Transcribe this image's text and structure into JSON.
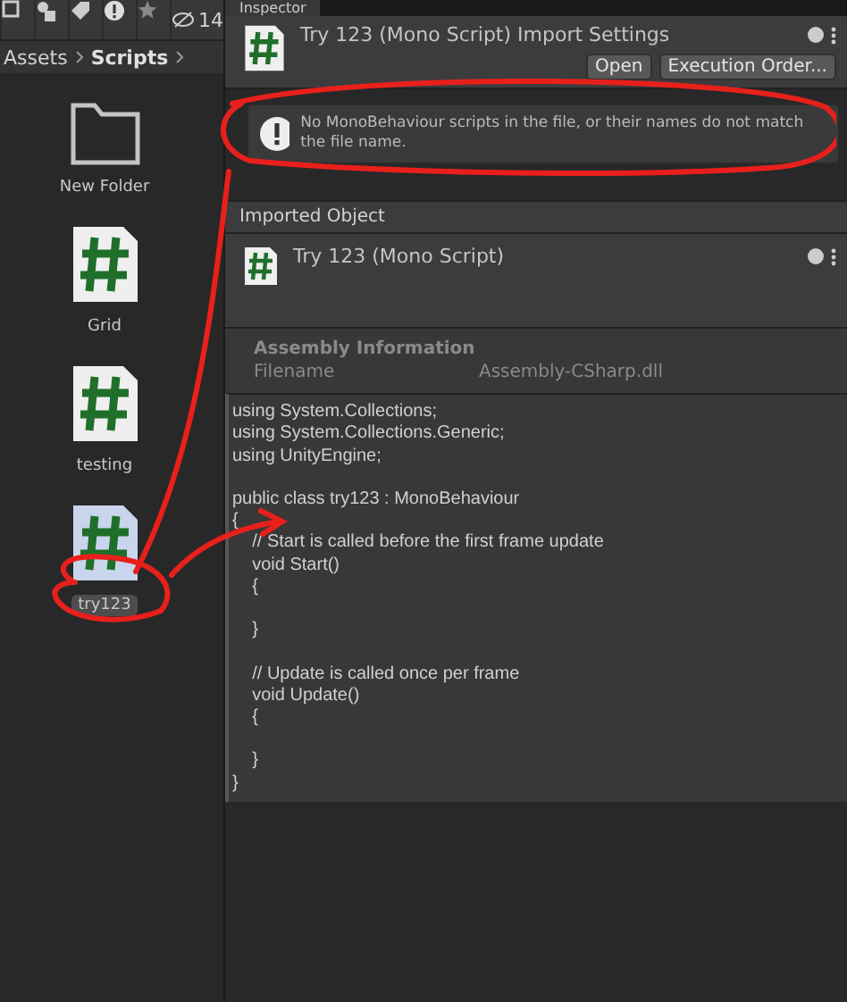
{
  "project_panel": {
    "toolbar": {
      "hidden_count": "14"
    },
    "breadcrumb": [
      "Assets",
      "Scripts"
    ],
    "assets": [
      {
        "name": "New Folder",
        "kind": "folder",
        "selected": false
      },
      {
        "name": "Grid",
        "kind": "script",
        "selected": false
      },
      {
        "name": "testing",
        "kind": "script",
        "selected": false
      },
      {
        "name": "try123",
        "kind": "script",
        "selected": true
      }
    ]
  },
  "inspector": {
    "tab": "Inspector",
    "title": "Try 123 (Mono Script) Import Settings",
    "buttons": [
      "Open",
      "Execution Order..."
    ],
    "warning": "No MonoBehaviour scripts in the file, or their names do not match the file name.",
    "section": "Imported Object",
    "object_title": "Try 123 (Mono Script)",
    "assembly": {
      "heading": "Assembly Information",
      "label": "Filename",
      "value": "Assembly-CSharp.dll"
    },
    "code": "using System.Collections;\nusing System.Collections.Generic;\nusing UnityEngine;\n\npublic class try123 : MonoBehaviour\n{\n    // Start is called before the first frame update\n    void Start()\n    {\n\n    }\n\n    // Update is called once per frame\n    void Update()\n    {\n\n    }\n}"
  }
}
